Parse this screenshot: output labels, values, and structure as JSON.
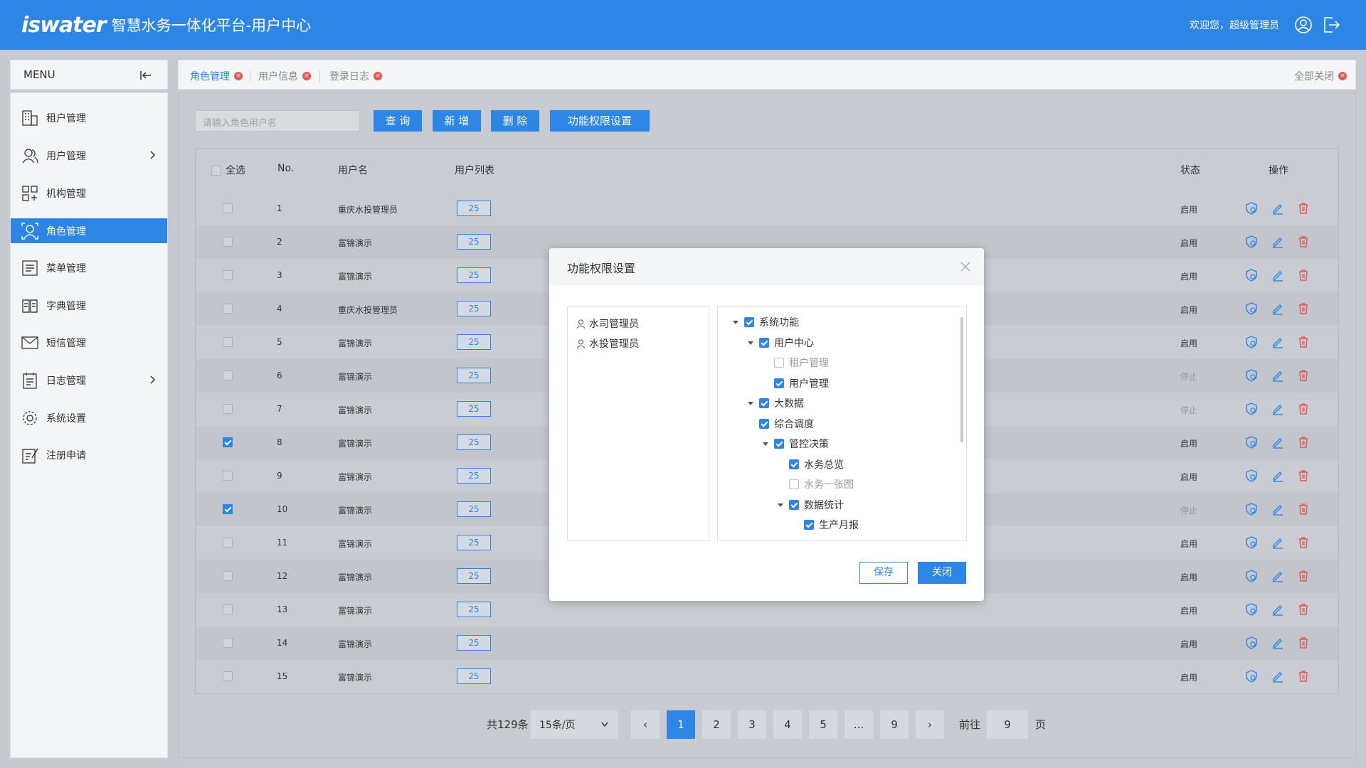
{
  "header": {
    "logo_mark": "iswater",
    "title": "智慧水务一体化平台-用户中心",
    "welcome": "欢迎您，超级管理员"
  },
  "sidebar": {
    "menu_label": "MENU",
    "items": [
      {
        "label": "租户管理",
        "icon": "building-icon"
      },
      {
        "label": "用户管理",
        "icon": "users-icon"
      },
      {
        "label": "机构管理",
        "icon": "org-icon"
      },
      {
        "label": "角色管理",
        "icon": "role-icon"
      },
      {
        "label": "菜单管理",
        "icon": "menu-list-icon"
      },
      {
        "label": "字典管理",
        "icon": "book-icon"
      },
      {
        "label": "短信管理",
        "icon": "mail-icon"
      },
      {
        "label": "日志管理",
        "icon": "log-icon"
      },
      {
        "label": "系统设置",
        "icon": "settings-icon"
      },
      {
        "label": "注册申请",
        "icon": "register-icon"
      }
    ],
    "active_index": 3
  },
  "tabs": {
    "items": [
      "角色管理",
      "用户信息",
      "登录日志"
    ],
    "close_all": "全部关闭"
  },
  "toolbar": {
    "search_placeholder": "请输入角色用户名",
    "query": "查 询",
    "add": "新 增",
    "delete": "删 除",
    "permission": "功能权限设置"
  },
  "table": {
    "headers": {
      "select_all": "全选",
      "no": "No.",
      "username": "用户名",
      "userlist": "用户列表",
      "status": "状态",
      "actions": "操作"
    },
    "rows": [
      {
        "no": "1",
        "name": "重庆水投管理员",
        "count": "25",
        "status": "启用",
        "checked": false
      },
      {
        "no": "2",
        "name": "富锦演示",
        "count": "25",
        "status": "启用",
        "checked": false
      },
      {
        "no": "3",
        "name": "富锦演示",
        "count": "25",
        "status": "启用",
        "checked": false
      },
      {
        "no": "4",
        "name": "重庆水投管理员",
        "count": "25",
        "status": "启用",
        "checked": false
      },
      {
        "no": "5",
        "name": "富锦演示",
        "count": "25",
        "status": "启用",
        "checked": false
      },
      {
        "no": "6",
        "name": "富锦演示",
        "count": "25",
        "status": "停止",
        "checked": false
      },
      {
        "no": "7",
        "name": "富锦演示",
        "count": "25",
        "status": "停止",
        "checked": false
      },
      {
        "no": "8",
        "name": "富锦演示",
        "count": "25",
        "status": "启用",
        "checked": true
      },
      {
        "no": "9",
        "name": "富锦演示",
        "count": "25",
        "status": "启用",
        "checked": false
      },
      {
        "no": "10",
        "name": "富锦演示",
        "count": "25",
        "status": "停止",
        "checked": true
      },
      {
        "no": "11",
        "name": "富锦演示",
        "count": "25",
        "status": "启用",
        "checked": false
      },
      {
        "no": "12",
        "name": "富锦演示",
        "count": "25",
        "status": "启用",
        "checked": false
      },
      {
        "no": "13",
        "name": "富锦演示",
        "count": "25",
        "status": "启用",
        "checked": false
      },
      {
        "no": "14",
        "name": "富锦演示",
        "count": "25",
        "status": "启用",
        "checked": false
      },
      {
        "no": "15",
        "name": "富锦演示",
        "count": "25",
        "status": "启用",
        "checked": false
      }
    ]
  },
  "pagination": {
    "total": "共129条",
    "per_page": "15条/页",
    "pages": [
      "1",
      "2",
      "3",
      "4",
      "5",
      "...",
      "9"
    ],
    "current": "1",
    "goto_label": "前往",
    "goto_value": "9",
    "page_suffix": "页"
  },
  "modal": {
    "title": "功能权限设置",
    "roles": [
      "水司管理员",
      "水投管理员"
    ],
    "tree": [
      {
        "label": "系统功能",
        "checked": true,
        "caret": true
      },
      {
        "label": "用户中心",
        "checked": true,
        "caret": true
      },
      {
        "label": "租户管理",
        "checked": false,
        "caret": false
      },
      {
        "label": "用户管理",
        "checked": true,
        "caret": false
      },
      {
        "label": "大数据",
        "checked": true,
        "caret": true
      },
      {
        "label": "综合调度",
        "checked": true,
        "caret": false
      },
      {
        "label": "管控决策",
        "checked": true,
        "caret": true
      },
      {
        "label": "水务总览",
        "checked": true,
        "caret": false
      },
      {
        "label": "水务一张图",
        "checked": false,
        "caret": false
      },
      {
        "label": "数据统计",
        "checked": true,
        "caret": true
      },
      {
        "label": "生产月报",
        "checked": true,
        "caret": false
      }
    ],
    "save": "保存",
    "close": "关闭"
  },
  "colors": {
    "primary": "#2d86e6",
    "danger": "#e45757",
    "enabled": "#333333",
    "stopped": "#9a9a9a"
  }
}
